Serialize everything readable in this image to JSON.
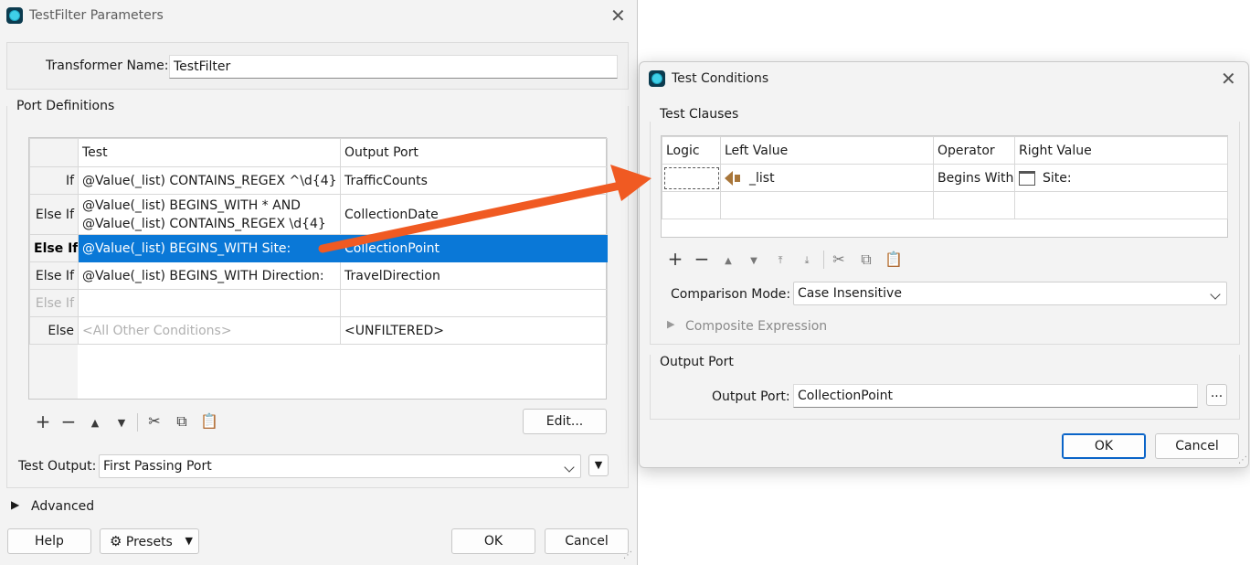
{
  "params_window": {
    "title": "TestFilter Parameters",
    "transformer_name_label": "Transformer Name:",
    "transformer_name_value": "TestFilter",
    "port_definitions_label": "Port Definitions",
    "columns": [
      "",
      "Test",
      "Output Port"
    ],
    "rows": [
      {
        "logic": "If",
        "test": "@Value(_list) CONTAINS_REGEX ^\\d{4}",
        "test2": "",
        "port": "TrafficCounts"
      },
      {
        "logic": "Else If",
        "test": "@Value(_list) BEGINS_WITH * AND",
        "test2": "@Value(_list) CONTAINS_REGEX \\d{4}",
        "port": "CollectionDate"
      },
      {
        "logic": "Else If",
        "test": "@Value(_list) BEGINS_WITH Site:",
        "test2": "",
        "port": "CollectionPoint"
      },
      {
        "logic": "Else If",
        "test": "@Value(_list) BEGINS_WITH Direction:",
        "test2": "",
        "port": "TravelDirection"
      },
      {
        "logic": "Else If",
        "test": "",
        "test2": "",
        "port": ""
      },
      {
        "logic": "Else",
        "test": "<All Other Conditions>",
        "test2": "",
        "port": "<UNFILTERED>"
      }
    ],
    "edit_button": "Edit...",
    "test_output_label": "Test Output:",
    "test_output_value": "First Passing Port",
    "advanced_label": "Advanced",
    "help_button": "Help",
    "presets_button": "Presets",
    "ok_button": "OK",
    "cancel_button": "Cancel"
  },
  "conditions_window": {
    "title": "Test Conditions",
    "clauses_label": "Test Clauses",
    "columns": [
      "Logic",
      "Left Value",
      "Operator",
      "Right Value"
    ],
    "clause": {
      "logic": "",
      "left": "_list",
      "operator": "Begins With",
      "right": "Site:"
    },
    "comparison_mode_label": "Comparison Mode:",
    "comparison_mode_value": "Case Insensitive",
    "composite_label": "Composite Expression",
    "output_port_group": "Output Port",
    "output_port_label": "Output Port:",
    "output_port_value": "CollectionPoint",
    "browse_button": "...",
    "ok_button": "OK",
    "cancel_button": "Cancel"
  },
  "colors": {
    "selection": "#0a78d7",
    "arrow": "#f05a22",
    "accent_border": "#0a64c8"
  }
}
